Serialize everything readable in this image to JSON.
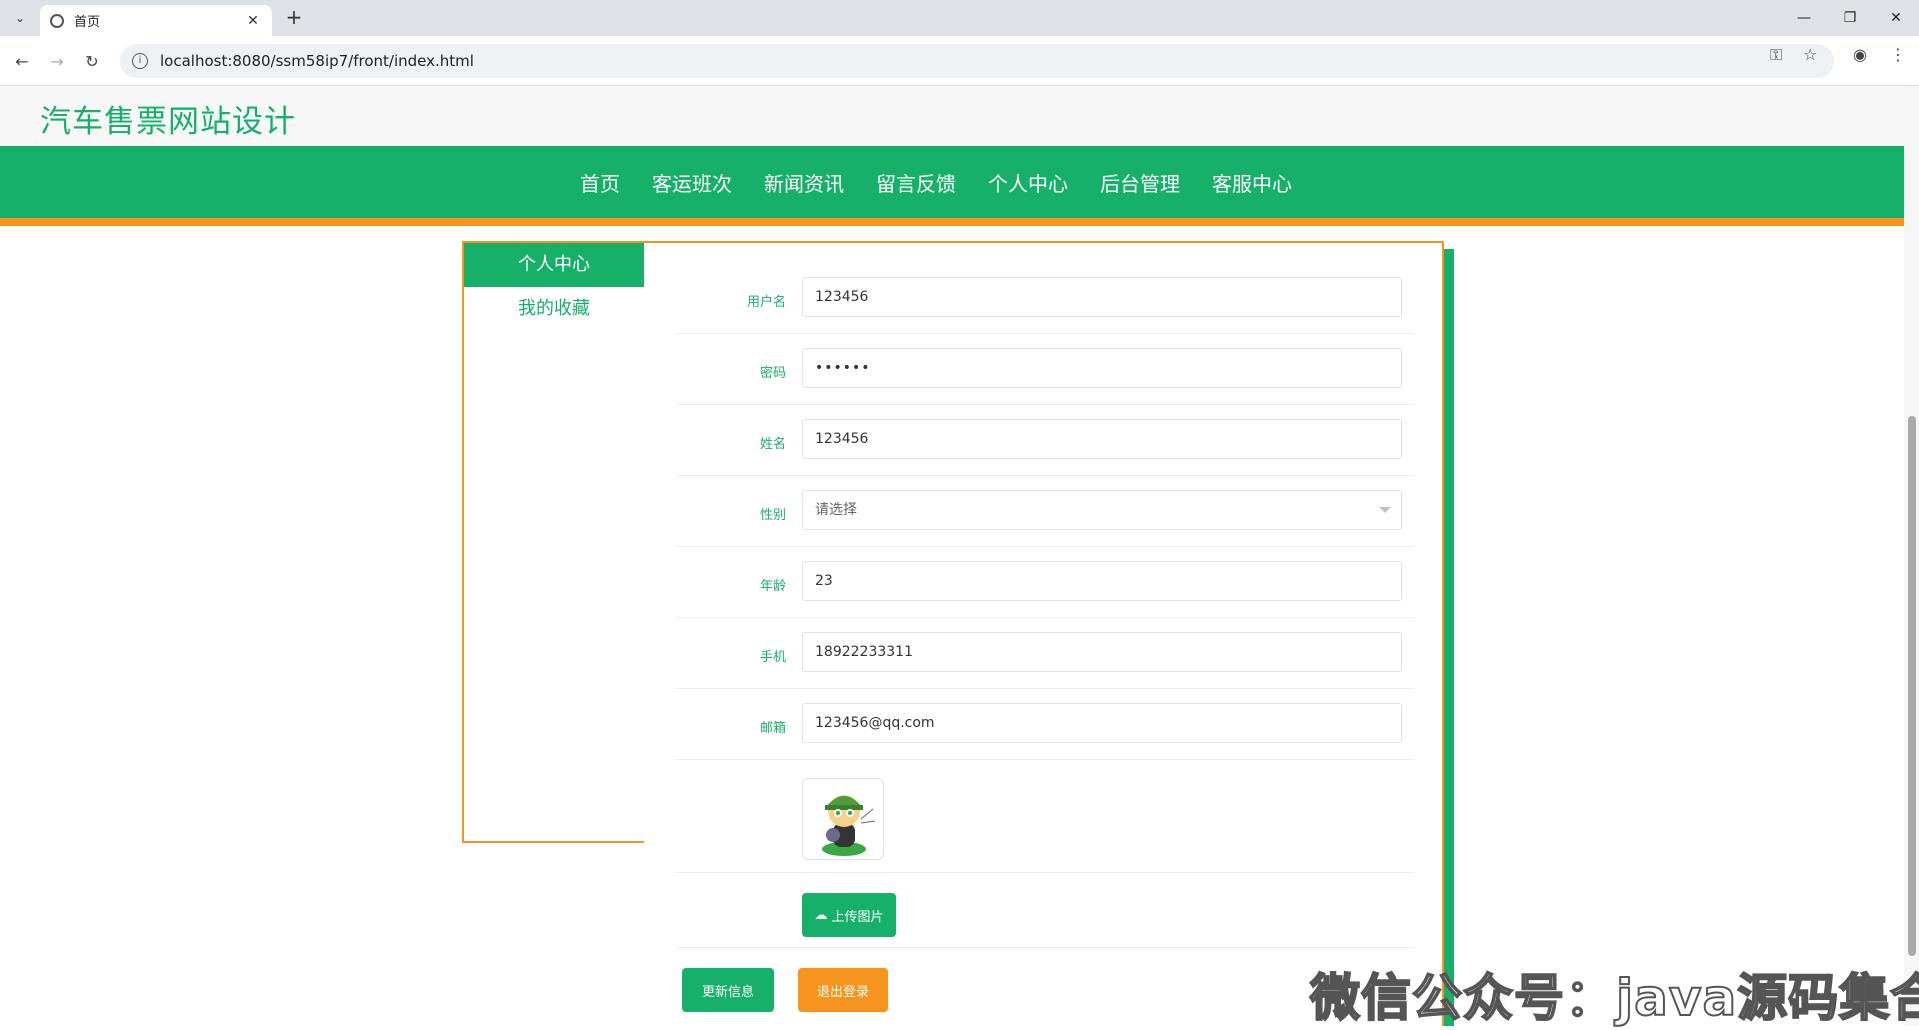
{
  "browser": {
    "tab_title": "首页",
    "url": "localhost:8080/ssm58ip7/front/index.html"
  },
  "site": {
    "title": "汽车售票网站设计"
  },
  "nav": {
    "items": [
      "首页",
      "客运班次",
      "新闻资讯",
      "留言反馈",
      "个人中心",
      "后台管理",
      "客服中心"
    ]
  },
  "sidebar": {
    "items": [
      {
        "label": "个人中心",
        "active": true
      },
      {
        "label": "我的收藏",
        "active": false
      }
    ]
  },
  "form": {
    "username": {
      "label": "用户名",
      "value": "123456"
    },
    "password": {
      "label": "密码",
      "value": "••••••"
    },
    "name": {
      "label": "姓名",
      "value": "123456"
    },
    "gender": {
      "label": "性别",
      "value": "请选择"
    },
    "age": {
      "label": "年龄",
      "value": "23"
    },
    "phone": {
      "label": "手机",
      "value": "18922233311"
    },
    "email": {
      "label": "邮箱",
      "value": "123456@qq.com"
    },
    "upload_label": "上传图片",
    "update_label": "更新信息",
    "logout_label": "退出登录"
  },
  "watermark": "微信公众号：java源码集合",
  "colors": {
    "primary": "#17b06b",
    "accent": "#f7941d"
  }
}
